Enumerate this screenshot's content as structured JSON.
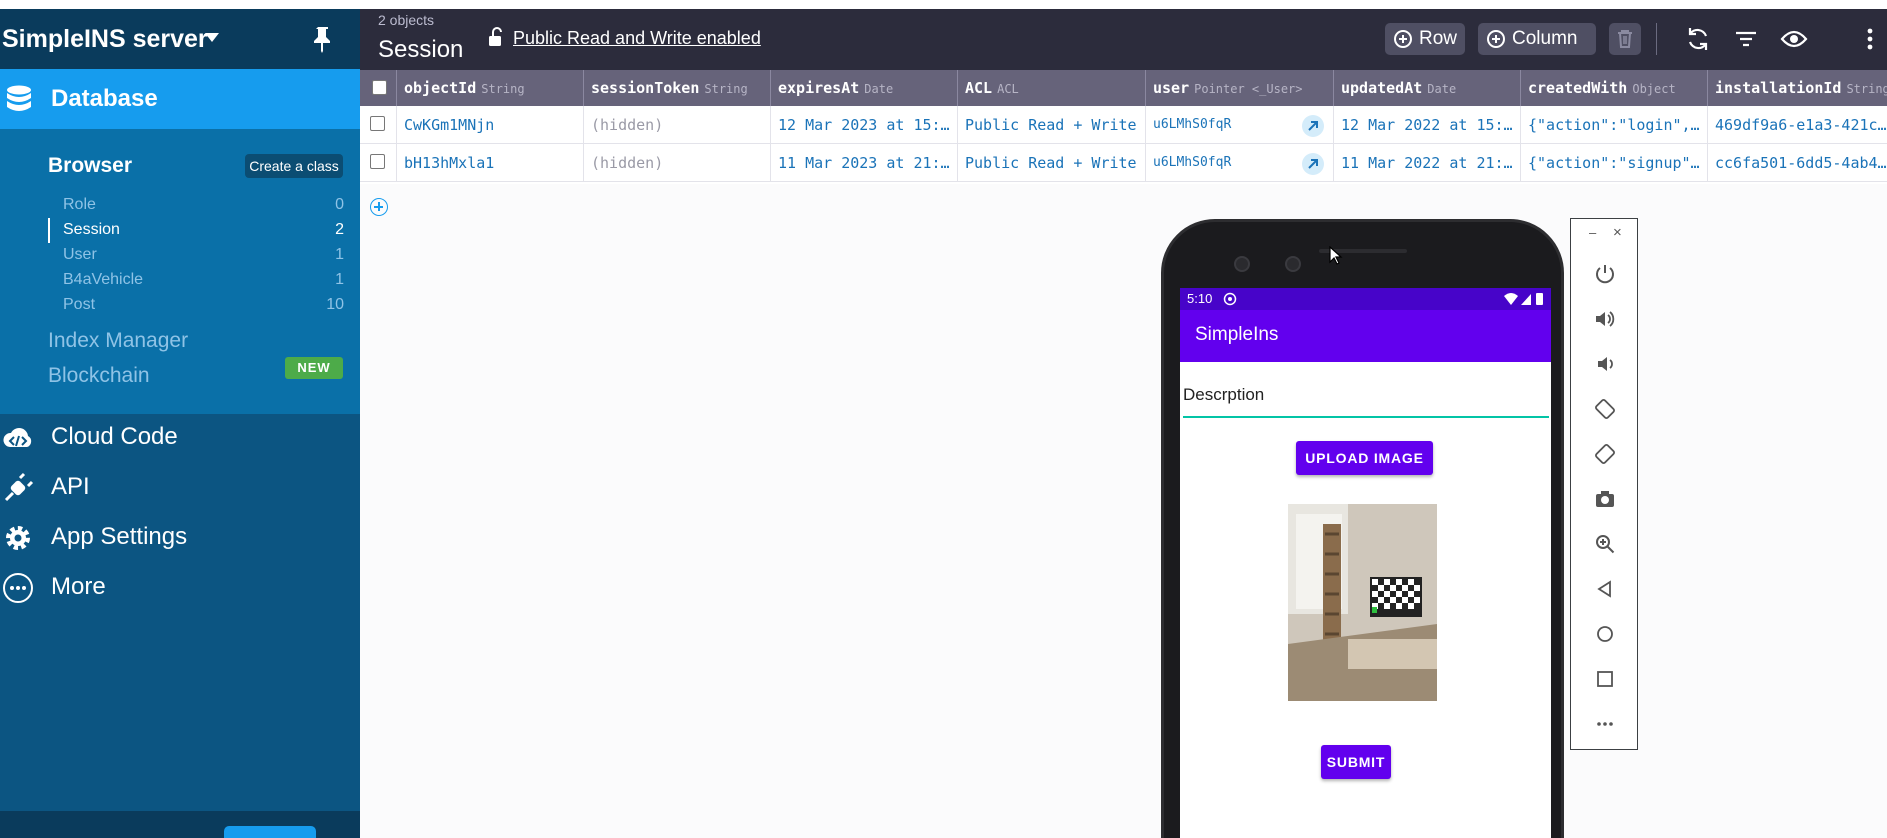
{
  "sidebar": {
    "app_name": "SimpleINS server",
    "database_label": "Database",
    "browser_label": "Browser",
    "create_class_label": "Create a class",
    "classes": [
      {
        "name": "Role",
        "count": "0"
      },
      {
        "name": "Session",
        "count": "2"
      },
      {
        "name": "User",
        "count": "1"
      },
      {
        "name": "B4aVehicle",
        "count": "1"
      },
      {
        "name": "Post",
        "count": "10"
      }
    ],
    "index_manager_label": "Index Manager",
    "blockchain_label": "Blockchain",
    "new_badge": "NEW",
    "nav": [
      {
        "label": "Cloud Code",
        "icon": "cloud-code-icon"
      },
      {
        "label": "API",
        "icon": "plug-icon"
      },
      {
        "label": "App Settings",
        "icon": "gear-icon"
      },
      {
        "label": "More",
        "icon": "more-icon"
      }
    ]
  },
  "toolbar": {
    "object_count": "2 objects",
    "class_name": "Session",
    "acl_text": "Public Read and Write enabled",
    "row_label": "Row",
    "column_label": "Column"
  },
  "table": {
    "columns": [
      {
        "name": "objectId",
        "type": "String"
      },
      {
        "name": "sessionToken",
        "type": "String"
      },
      {
        "name": "expiresAt",
        "type": "Date"
      },
      {
        "name": "ACL",
        "type": "ACL"
      },
      {
        "name": "user",
        "type": "Pointer <_User>"
      },
      {
        "name": "updatedAt",
        "type": "Date"
      },
      {
        "name": "createdWith",
        "type": "Object"
      },
      {
        "name": "installationId",
        "type": "String"
      }
    ],
    "rows": [
      {
        "objectId": "CwKGm1MNjn",
        "sessionToken": "(hidden)",
        "expiresAt": "12 Mar 2023 at 15:…",
        "ACL": "Public Read + Write",
        "user": "u6LMhS0fqR",
        "updatedAt": "12 Mar 2022 at 15:…",
        "createdWith": "{\"action\":\"login\",…",
        "installationId": "469df9a6-e1a3-421c…"
      },
      {
        "objectId": "bH13hMxla1",
        "sessionToken": "(hidden)",
        "expiresAt": "11 Mar 2023 at 21:…",
        "ACL": "Public Read + Write",
        "user": "u6LMhS0fqR",
        "updatedAt": "11 Mar 2022 at 21:…",
        "createdWith": "{\"action\":\"signup\"…",
        "installationId": "cc6fa501-6dd5-4ab4…"
      }
    ]
  },
  "emulator": {
    "status_time": "5:10",
    "app_title": "SimpleIns",
    "description_value": "Descrption",
    "upload_label": "UPLOAD IMAGE",
    "submit_label": "SUBMIT",
    "minimize_label": "–",
    "close_label": "×"
  },
  "colors": {
    "sidebar_dark": "#0a3b5c",
    "sidebar": "#0c5582",
    "accent": "#169cee",
    "toolbar": "#2c2c3c",
    "android_primary": "#6200ee",
    "new_badge": "#4dab49"
  }
}
